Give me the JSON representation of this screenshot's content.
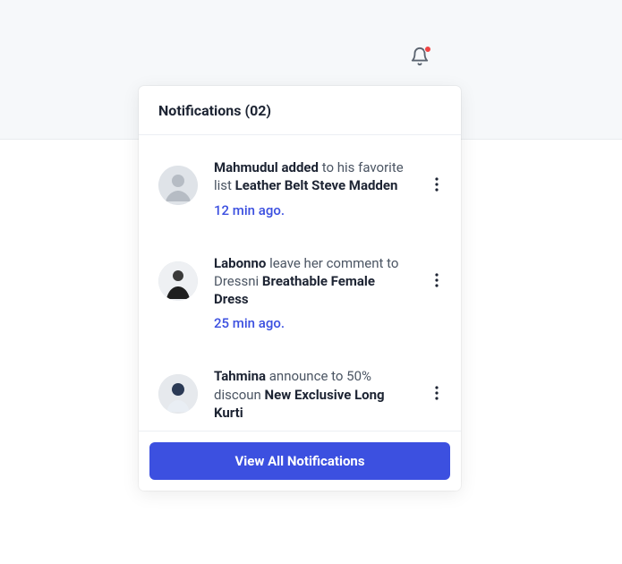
{
  "header": {
    "title": "Notifications (02)"
  },
  "notifications": [
    {
      "actor": "Mahmudul",
      "action_prefix": " added",
      "middle": " to his favorite list ",
      "object": "Leather Belt Steve Madden",
      "time": "12 min ago."
    },
    {
      "actor": "Labonno",
      "action_prefix": "",
      "middle": " leave her comment to Dressni ",
      "object": "Breathable Female Dress",
      "time": "25 min ago."
    },
    {
      "actor": "Tahmina",
      "action_prefix": "",
      "middle": " announce to 50% discoun ",
      "object": "New Exclusive Long Kurti",
      "time": ""
    }
  ],
  "footer": {
    "button_label": "View All Notifications"
  },
  "icons": {
    "bell": "bell-icon",
    "dots": "more-vertical-icon"
  }
}
